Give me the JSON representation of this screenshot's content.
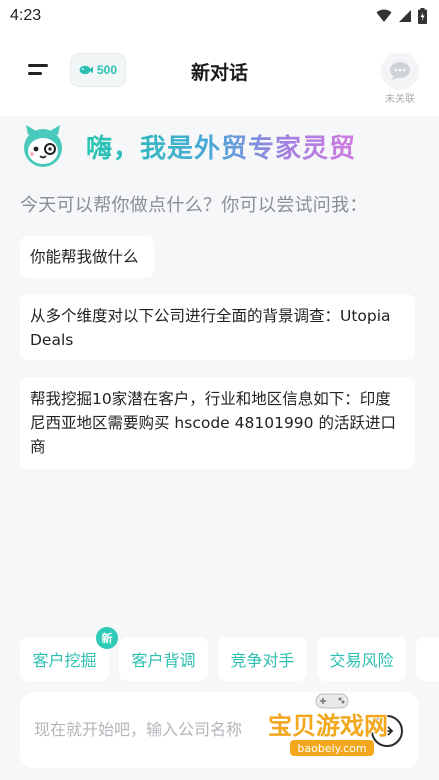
{
  "status_bar": {
    "time": "4:23"
  },
  "header": {
    "credits": "500",
    "title": "新对话",
    "link_status_label": "未关联"
  },
  "greeting": {
    "text": "嗨，我是外贸专家灵贸"
  },
  "subtitle": "今天可以帮你做点什么？你可以尝试问我：",
  "suggestions": [
    {
      "text": "你能帮我做什么"
    },
    {
      "text": "从多个维度对以下公司进行全面的背景调查：Utopia Deals"
    },
    {
      "text": "帮我挖掘10家潜在客户，行业和地区信息如下：印度尼西亚地区需要购买 hscode 48101990 的活跃进口商"
    }
  ],
  "chips": [
    {
      "label": "客户挖掘"
    },
    {
      "label": "客户背调"
    },
    {
      "label": "竞争对手"
    },
    {
      "label": "交易风险"
    }
  ],
  "new_badge": "新",
  "input": {
    "placeholder": "现在就开始吧，输入公司名称",
    "value": ""
  },
  "watermark": {
    "text": "宝贝游戏网",
    "url": "baobeiy.com"
  },
  "colors": {
    "accent": "#2dbfb0",
    "background": "#f6f7f9",
    "watermark": "#f2a71d"
  }
}
